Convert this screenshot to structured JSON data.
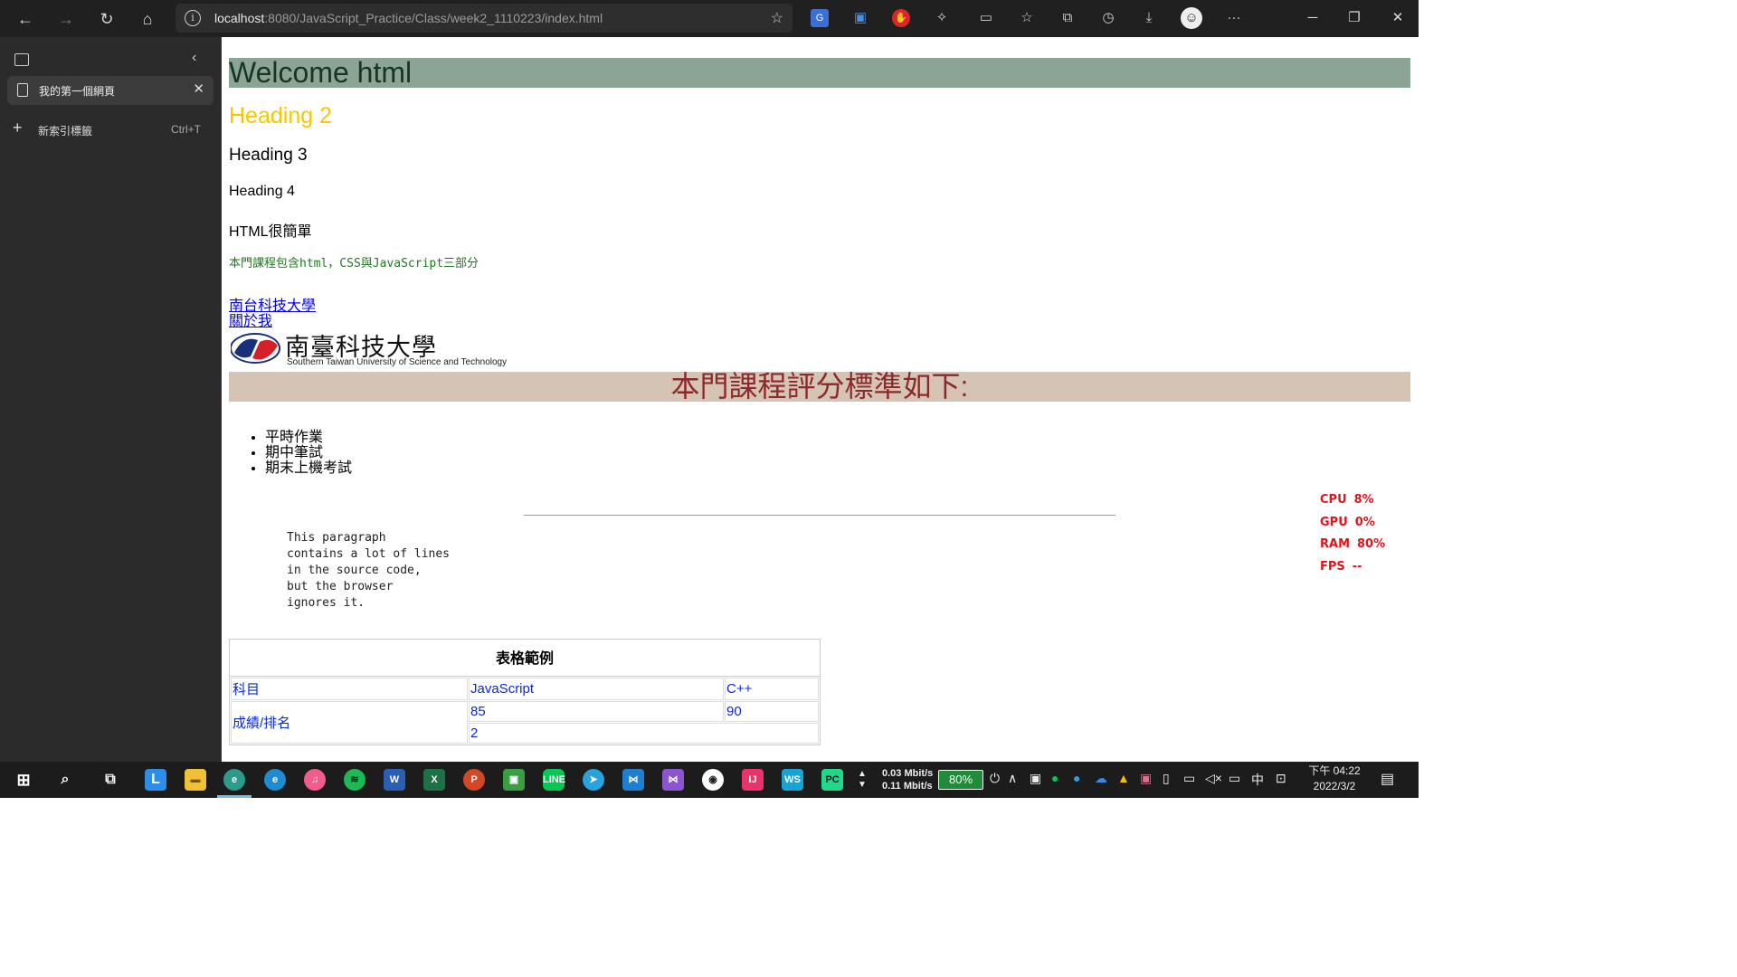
{
  "browser": {
    "url_host": "localhost",
    "url_path": ":8080/JavaScript_Practice/Class/week2_1110223/index.html",
    "sidebar": {
      "active_tab_title": "我的第一個網頁",
      "new_tab_label": "新索引標籤",
      "new_tab_shortcut": "Ctrl+T"
    }
  },
  "page": {
    "h1": "Welcome html",
    "h2": "Heading 2",
    "h3": "Heading 3",
    "h4": "Heading 4",
    "paragraph": "HTML很簡單",
    "green_note": "本門課程包含html，CSS與JavaScript三部分",
    "links": [
      "南台科技大學",
      "關於我"
    ],
    "logo": {
      "chinese_name": "南臺科技大學",
      "english_name": "Southern Taiwan University of Science and Technology"
    },
    "grading_heading": "本門課程評分標準如下:",
    "grading_items": [
      "平時作業",
      "期中筆試",
      "期末上機考試"
    ],
    "pre_text": "This paragraph\ncontains a lot of lines\nin the source code,\nbut the browser\nignores it.",
    "table": {
      "caption": "表格範例",
      "header": [
        "科目",
        "JavaScript",
        "C++"
      ],
      "row_label": "成績/排名",
      "scores": [
        "85",
        "90"
      ],
      "rank": "2"
    },
    "colors": {
      "h1_bg": "#8ca494",
      "h2_text": "#f7c700",
      "grading_bg": "#d5c3b3",
      "grading_text": "#8b2a2a",
      "table_text": "#0a2bd1"
    }
  },
  "overlay_stats": {
    "cpu_label": "CPU",
    "cpu_value": "8%",
    "gpu_label": "GPU",
    "gpu_value": "0%",
    "ram_label": "RAM",
    "ram_value": "80%",
    "fps_label": "FPS",
    "fps_value": "--"
  },
  "taskbar": {
    "net_up": "0.03 Mbit/s",
    "net_down": "0.11 Mbit/s",
    "battery": "80%",
    "ime": "中",
    "time": "下午 04:22",
    "date": "2022/3/2"
  }
}
